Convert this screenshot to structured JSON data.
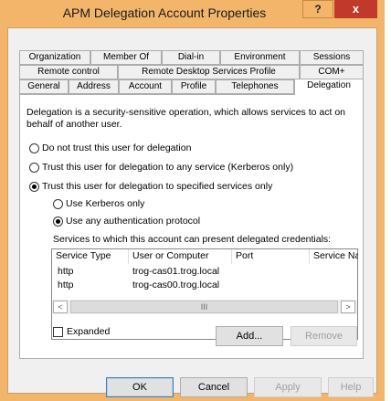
{
  "window": {
    "title": "APM Delegation Account Properties",
    "help_label": "?",
    "close_label": "x"
  },
  "tabs": {
    "row1": [
      "Organization",
      "Member Of",
      "Dial-in",
      "Environment",
      "Sessions"
    ],
    "row2": [
      "Remote control",
      "Remote Desktop Services Profile",
      "COM+"
    ],
    "row3": [
      "General",
      "Address",
      "Account",
      "Profile",
      "Telephones",
      "Delegation"
    ],
    "active": "Delegation"
  },
  "delegation": {
    "description_line1": "Delegation is a security-sensitive operation, which allows services to act on",
    "description_line2": "behalf of another user.",
    "options": [
      {
        "label": "Do not trust this user for delegation",
        "selected": false
      },
      {
        "label": "Trust this user for delegation to any service (Kerberos only)",
        "selected": false
      },
      {
        "label": "Trust this user for delegation to specified services only",
        "selected": true
      }
    ],
    "sub_options": [
      {
        "label": "Use Kerberos only",
        "selected": false
      },
      {
        "label": "Use any authentication protocol",
        "selected": true
      }
    ],
    "services_caption": "Services to which this account can present delegated credentials:",
    "columns": [
      "Service Type",
      "User or Computer",
      "Port",
      "Service Na"
    ],
    "rows": [
      {
        "service_type": "http",
        "computer": "trog-cas01.trog.local",
        "port": "",
        "service_name": ""
      },
      {
        "service_type": "http",
        "computer": "trog-cas00.trog.local",
        "port": "",
        "service_name": ""
      }
    ],
    "scroll_left": "<",
    "scroll_right": ">",
    "scroll_thumb": "III",
    "expanded_label": "Expanded",
    "expanded_checked": false,
    "add_label": "Add...",
    "remove_label": "Remove"
  },
  "footer": {
    "ok_label": "OK",
    "cancel_label": "Cancel",
    "apply_label": "Apply",
    "help_label": "Help"
  }
}
